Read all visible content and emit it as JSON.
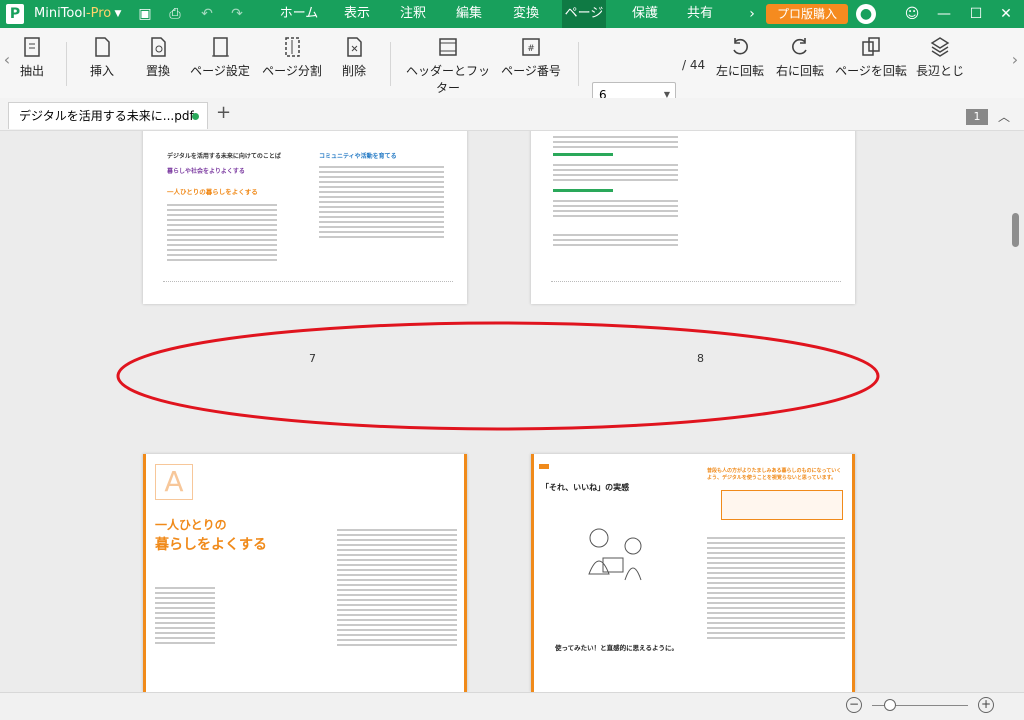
{
  "app": {
    "name": "MiniTool",
    "name_suffix": "-Pro",
    "logo_letter": "P"
  },
  "menus": [
    "ホーム",
    "表示",
    "注釈",
    "編集",
    "変換",
    "ページ",
    "保護",
    "共有"
  ],
  "buy_label": "プロ版購入",
  "tools": {
    "extract": "抽出",
    "insert": "挿入",
    "replace": "置換",
    "page_settings": "ページ設定",
    "page_split": "ページ分割",
    "delete": "削除",
    "header_footer": "ヘッダーとフッター",
    "page_number": "ページ番号",
    "rotate_left": "左に回転",
    "rotate_right": "右に回転",
    "rotate_page": "ページを回転",
    "long_edge": "長辺とじ"
  },
  "page_select": {
    "value": "6",
    "total": "/ 44"
  },
  "tab": {
    "title": "デジタルを活用する未来に...pdf",
    "page_badge": "1"
  },
  "thumbnails": {
    "page7": {
      "number": "7",
      "heading1": "デジタルを活用する未来に向けてのことば",
      "heading2": "暮らしや社会をよりよくする",
      "chapter": "一人ひとりの暮らしをよくする",
      "section": "コミュニティや活動を育てる"
    },
    "page8": {
      "number": "8"
    },
    "page9": {
      "title_line1": "一人ひとりの",
      "title_line2": "暮らしをよくする"
    },
    "page10": {
      "title": "「それ、いいね」の実感",
      "caption": "使ってみたい！と直感的に思えるように。",
      "quote": "普段も人の方がよりたましみある暮らしのものになっていくよう、デジタルを使うことを視覚らないと思っています。"
    }
  },
  "colors": {
    "brand": "#18a05c",
    "buy": "#f58b1f",
    "accent_orange": "#f08a1a",
    "annotation": "#e0141e"
  }
}
